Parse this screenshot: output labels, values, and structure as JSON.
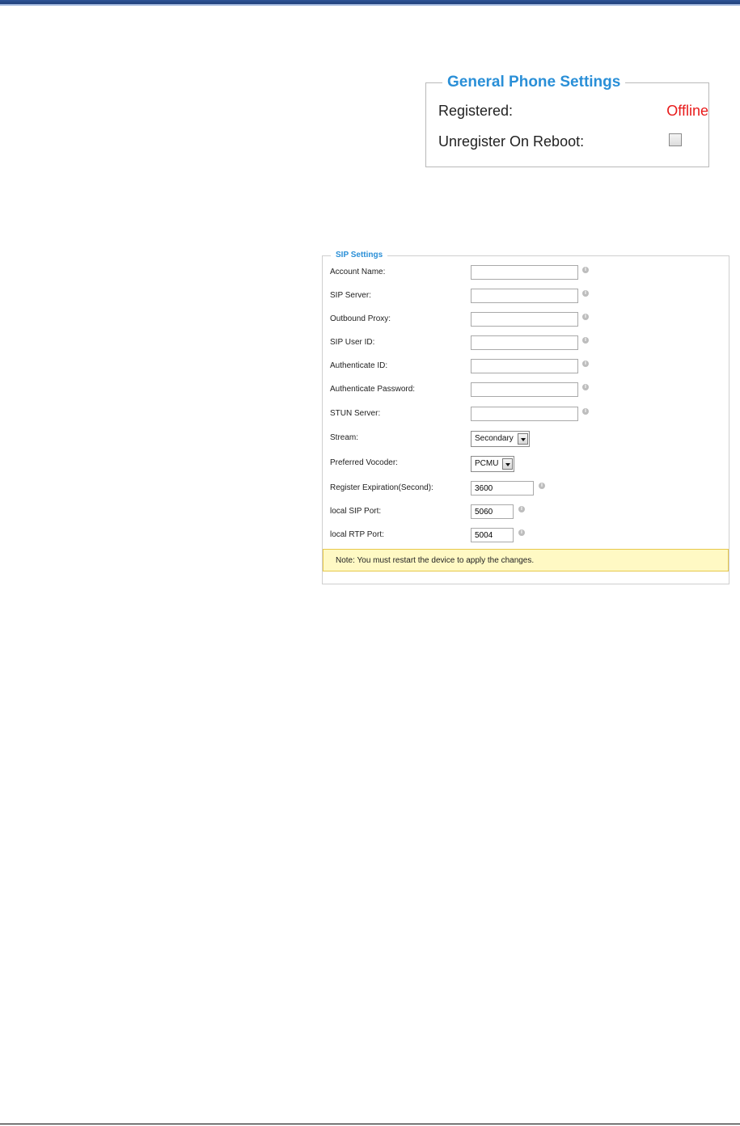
{
  "general_phone_settings": {
    "title": "General Phone Settings",
    "registered_label": "Registered:",
    "registered_value": "Offline",
    "unregister_label": "Unregister On Reboot:",
    "unregister_checked": false
  },
  "sip_settings": {
    "title": "SIP Settings",
    "account_name_label": "Account Name:",
    "sip_server_label": "SIP Server:",
    "outbound_proxy_label": "Outbound Proxy:",
    "sip_user_id_label": "SIP User ID:",
    "authenticate_id_label": "Authenticate ID:",
    "authenticate_password_label": "Authenticate Password:",
    "stun_server_label": "STUN Server:",
    "stream_label": "Stream:",
    "stream_value": "Secondary",
    "preferred_vocoder_label": "Preferred Vocoder:",
    "preferred_vocoder_value": "PCMU",
    "register_expiration_label": "Register Expiration(Second):",
    "register_expiration_value": "3600",
    "local_sip_port_label": "local SIP Port:",
    "local_sip_port_value": "5060",
    "local_rtp_port_label": "local RTP Port:",
    "local_rtp_port_value": "5004",
    "note": "Note: You must restart the device to apply the changes."
  },
  "icons": {
    "info": "info-icon",
    "dropdown": "chevron-down-icon"
  },
  "colors": {
    "legend_blue": "#2a8fd7",
    "offline_red": "#e81a1a",
    "note_background": "#fff9c4"
  }
}
